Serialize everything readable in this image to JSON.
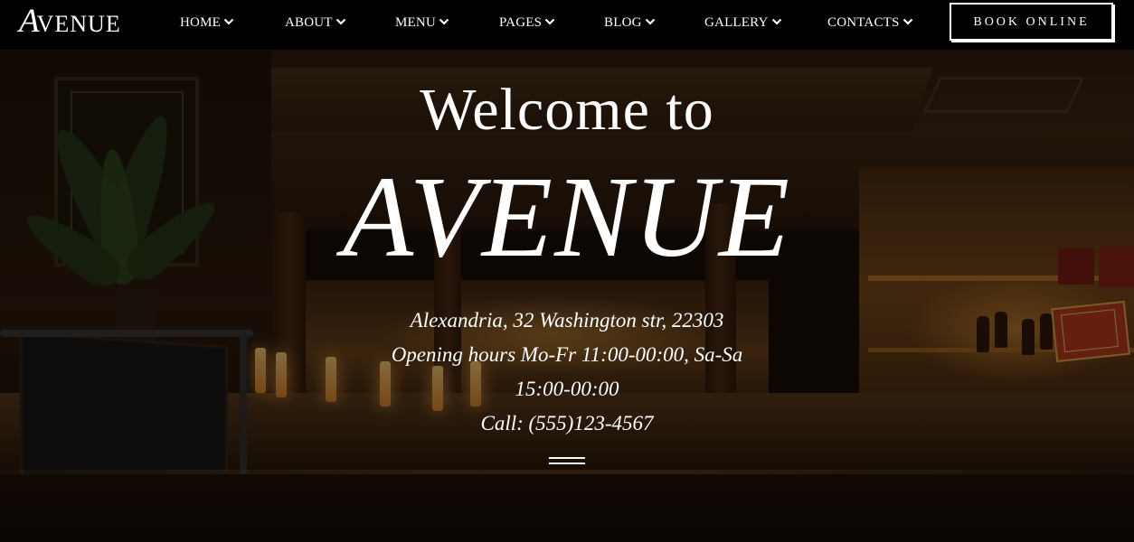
{
  "brand": {
    "logo_initial": "A",
    "logo_rest": "VENUE"
  },
  "nav": {
    "items": [
      {
        "label": "HOME"
      },
      {
        "label": "ABOUT"
      },
      {
        "label": "MENU"
      },
      {
        "label": "PAGES"
      },
      {
        "label": "BLOG"
      },
      {
        "label": "GALLERY"
      },
      {
        "label": "CONTACTS"
      }
    ],
    "cta_label": "BOOK ONLINE"
  },
  "hero": {
    "welcome": "Welcome to",
    "title": "AVENUE",
    "address": "Alexandria, 32 Washington str, 22303",
    "hours_line1": "Opening hours Mo-Fr 11:00-00:00, Sa-Sa",
    "hours_line2": "15:00-00:00",
    "phone": "Call: (555)123-4567"
  },
  "colors": {
    "navbar_bg": "#000000",
    "text": "#ffffff",
    "hero_overlay": "#080401"
  },
  "icons": {
    "nav_dropdown": "chevron-down-icon",
    "divider": "double-line-divider"
  }
}
